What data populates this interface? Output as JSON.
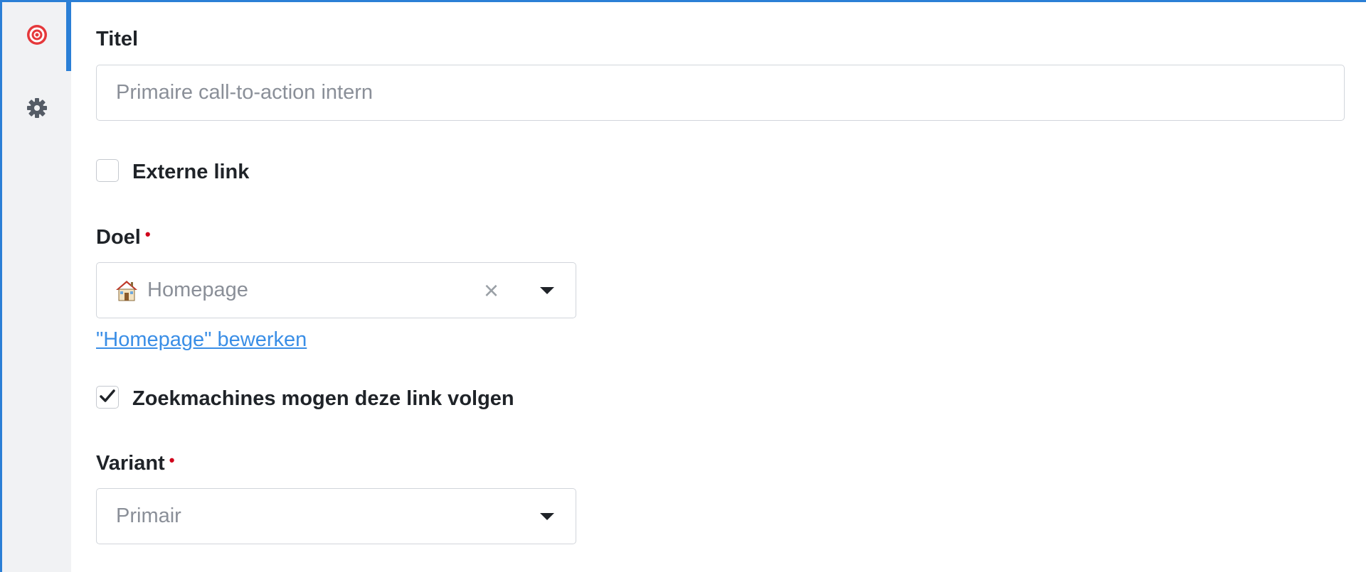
{
  "sidebar": {
    "items": [
      {
        "name": "target",
        "icon": "target-icon",
        "active": true
      },
      {
        "name": "settings",
        "icon": "gear-icon",
        "active": false
      }
    ]
  },
  "form": {
    "title": {
      "label": "Titel",
      "placeholder": "Primaire call-to-action intern",
      "value": ""
    },
    "external_link": {
      "label": "Externe link",
      "checked": false
    },
    "goal": {
      "label": "Doel",
      "required_mark": "•",
      "value": "Homepage",
      "icon": "house-icon",
      "clear_symbol": "×"
    },
    "edit_link": "\"Homepage\" bewerken",
    "follow": {
      "label": "Zoekmachines mogen deze link volgen",
      "checked": true
    },
    "variant": {
      "label": "Variant",
      "required_mark": "•",
      "value": "Primair"
    }
  },
  "colors": {
    "accent": "#2b7fd6",
    "link": "#3a8ee6",
    "required": "#d0021b",
    "target_icon": "#e5383b"
  }
}
